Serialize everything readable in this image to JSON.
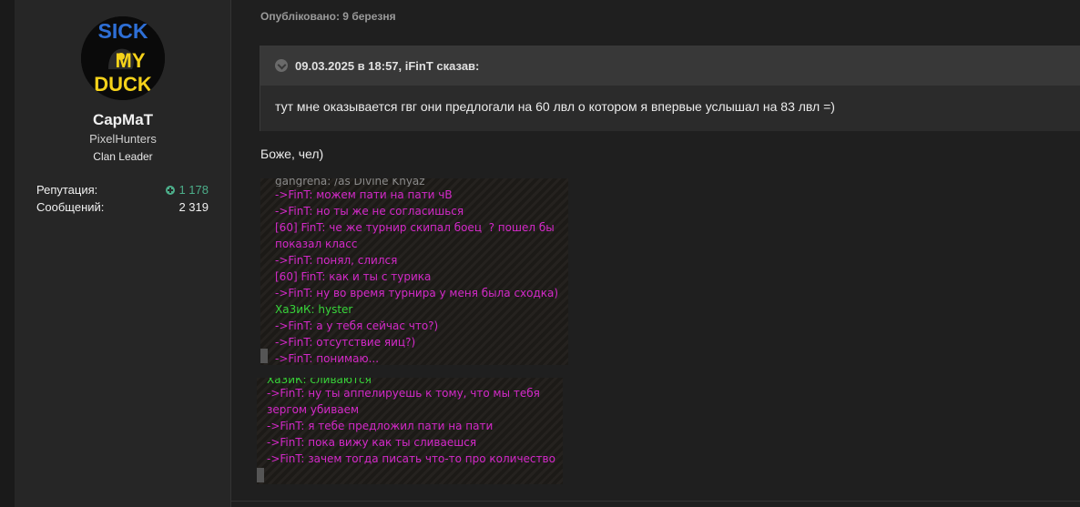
{
  "author": {
    "avatar_text": [
      "SICK",
      "MY",
      "DUCK"
    ],
    "username": "CapMaT",
    "clan": "PixelHunters",
    "rank": "Clan Leader",
    "stats": {
      "reputation_label": "Репутация:",
      "reputation_value": "1 178",
      "messages_label": "Сообщений:",
      "messages_value": "2 319"
    }
  },
  "post": {
    "published": "Опубліковано: 9 березня",
    "quote": {
      "header": "09.03.2025 в 18:57, iFinT сказав:",
      "text": "тут мне оказывается гвг они предлогали на 60 лвл о котором я впервые услышал на 83 лвл  =)"
    },
    "text": "Боже, чел)",
    "screenshot1": [
      {
        "text": "gangrena: /as Divine Knyaz",
        "color": "cut"
      },
      {
        "text": "->FinT: можем пати на пати чВ",
        "color": "pink"
      },
      {
        "text": "->FinT: но ты же не согласишься",
        "color": "pink"
      },
      {
        "text": "[60] FinT: че же турнир скипал боец  ? пошел бы показал класс",
        "color": "pink"
      },
      {
        "text": "->FinT: понял, слился",
        "color": "pink"
      },
      {
        "text": "[60] FinT: как и ты с турика",
        "color": "pink"
      },
      {
        "text": "->FinT: ну во время турнира у меня была сходка)",
        "color": "pink"
      },
      {
        "text": "Ха3иК: hyster",
        "color": "green"
      },
      {
        "text": "->FinT: а у тебя сейчас что?)",
        "color": "pink"
      },
      {
        "text": "->FinT: отсутствие яиц?)",
        "color": "pink"
      },
      {
        "text": "->FinT: понимаю...",
        "color": "pink"
      }
    ],
    "screenshot2": [
      {
        "text": "Ха3иК: сливаются",
        "color": "cutg"
      },
      {
        "text": "->FinT: ну ты аппелируешь к тому, что мы тебя зергом убиваем",
        "color": "pink"
      },
      {
        "text": "->FinT: я тебе предложил пати на пати",
        "color": "pink"
      },
      {
        "text": "->FinT: пока вижу как ты сливаешся",
        "color": "pink"
      },
      {
        "text": "->FinT: зачем тогда писать что-то про количество",
        "color": "pink"
      }
    ]
  },
  "colors": {
    "reputation": "#4cae8a",
    "chat_pink": "#d429c9",
    "chat_green": "#37d43a"
  }
}
